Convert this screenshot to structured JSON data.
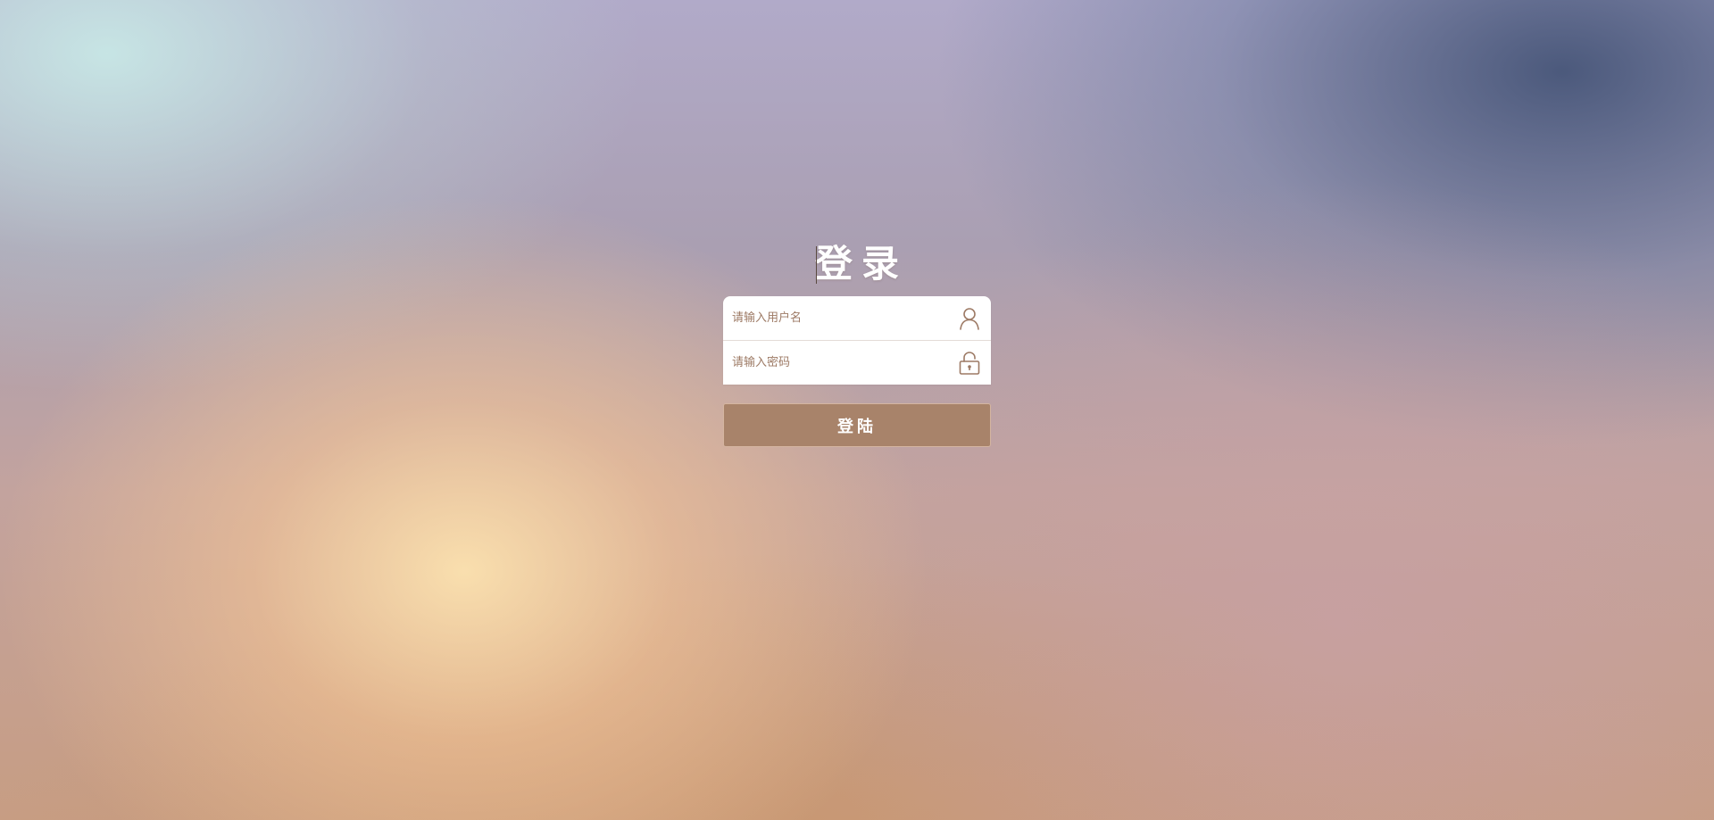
{
  "login": {
    "title": "登录",
    "username_placeholder": "请输入用户名",
    "password_placeholder": "请输入密码",
    "submit_label": "登陆",
    "username_icon": "user-icon",
    "password_icon": "unlock-icon"
  },
  "colors": {
    "accent": "#a8836a",
    "icon": "#9d7a65",
    "title_text": "#ffffff"
  }
}
